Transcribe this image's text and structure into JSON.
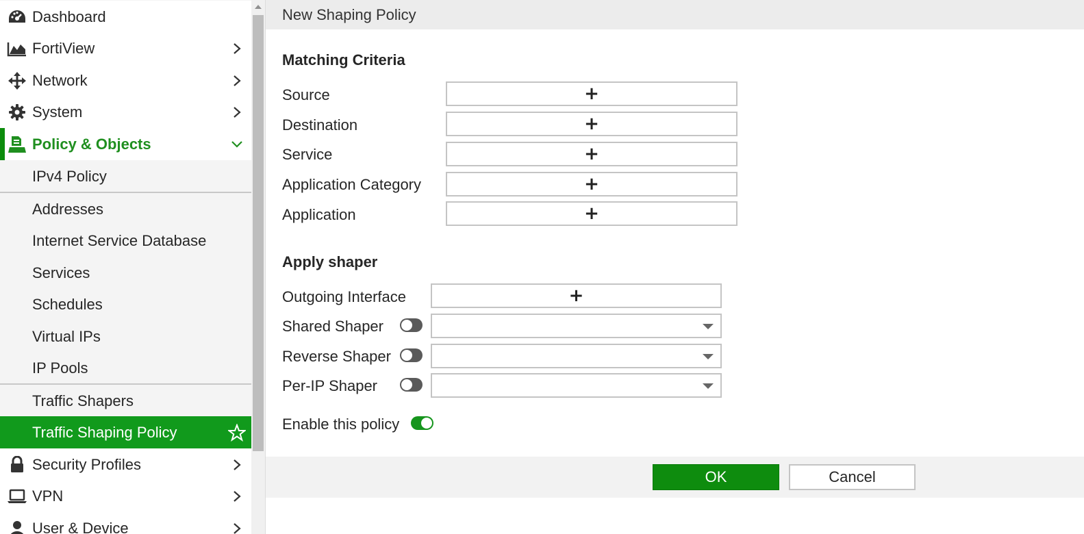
{
  "sidebar": {
    "items": [
      {
        "label": "Dashboard",
        "icon": "dashboard-icon"
      },
      {
        "label": "FortiView",
        "icon": "fortiview-icon"
      },
      {
        "label": "Network",
        "icon": "network-icon"
      },
      {
        "label": "System",
        "icon": "gear-icon"
      },
      {
        "label": "Policy & Objects",
        "icon": "policy-objects-icon"
      },
      {
        "label": "Security Profiles",
        "icon": "lock-icon"
      },
      {
        "label": "VPN",
        "icon": "laptop-icon"
      },
      {
        "label": "User & Device",
        "icon": "user-icon"
      }
    ],
    "sub_items": [
      {
        "label": "IPv4 Policy"
      },
      {
        "label": "Addresses"
      },
      {
        "label": "Internet Service Database"
      },
      {
        "label": "Services"
      },
      {
        "label": "Schedules"
      },
      {
        "label": "Virtual IPs"
      },
      {
        "label": "IP Pools"
      },
      {
        "label": "Traffic Shapers"
      },
      {
        "label": "Traffic Shaping Policy"
      }
    ],
    "selected": "Traffic Shaping Policy"
  },
  "page": {
    "title": "New Shaping Policy"
  },
  "matching": {
    "title": "Matching Criteria",
    "fields": [
      {
        "label": "Source"
      },
      {
        "label": "Destination"
      },
      {
        "label": "Service"
      },
      {
        "label": "Application Category"
      },
      {
        "label": "Application"
      }
    ]
  },
  "shaper": {
    "title": "Apply shaper",
    "outgoing_label": "Outgoing Interface",
    "shared_label": "Shared Shaper",
    "reverse_label": "Reverse Shaper",
    "perip_label": "Per-IP Shaper",
    "enable_label": "Enable this policy"
  },
  "buttons": {
    "ok": "OK",
    "cancel": "Cancel"
  },
  "colors": {
    "accent": "#119a1c",
    "active_text": "#1f8f1f"
  }
}
